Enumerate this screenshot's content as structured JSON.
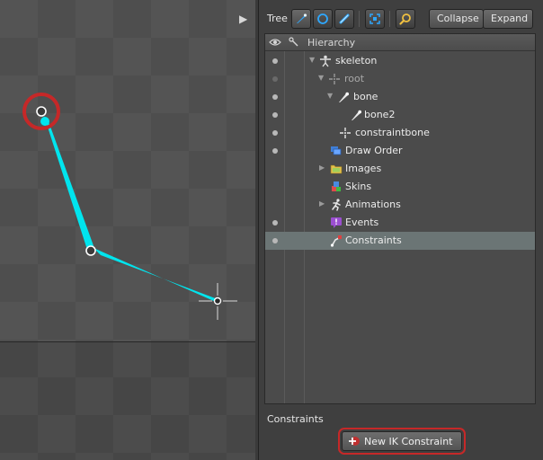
{
  "viewport": {
    "expand_arrow": "▶"
  },
  "toolbar": {
    "tree_label": "Tree",
    "icons": [
      "bone-tool-icon",
      "circle-icon",
      "link-icon",
      "frame-icon",
      "search-icon"
    ],
    "collapse_label": "Collapse",
    "expand_label": "Expand"
  },
  "tree": {
    "header": {
      "visibility_icon": "eye-icon",
      "keying_icon": "bone-link-icon",
      "title": "Hierarchy"
    },
    "rows": [
      {
        "label": "skeleton",
        "icon": "skeleton-icon",
        "visible": true,
        "expander": "down",
        "dim": false
      },
      {
        "label": "root",
        "icon": "crosshair-icon",
        "visible": false,
        "expander": "down",
        "dim": true
      },
      {
        "label": "bone",
        "icon": "bone-icon",
        "visible": true,
        "expander": "down",
        "dim": false
      },
      {
        "label": "bone2",
        "icon": "bone-icon",
        "visible": true,
        "expander": "none",
        "dim": false
      },
      {
        "label": "constraintbone",
        "icon": "crosshair-icon",
        "visible": true,
        "expander": "none",
        "dim": false
      },
      {
        "label": "Draw Order",
        "icon": "draw-order-icon",
        "visible": true,
        "expander": "none",
        "dim": false
      },
      {
        "label": "Images",
        "icon": "folder-icon",
        "visible": false,
        "expander": "right",
        "dim": false
      },
      {
        "label": "Skins",
        "icon": "skins-icon",
        "visible": false,
        "expander": "none",
        "dim": false
      },
      {
        "label": "Animations",
        "icon": "animation-icon",
        "visible": false,
        "expander": "right",
        "dim": false
      },
      {
        "label": "Events",
        "icon": "event-icon",
        "visible": true,
        "expander": "none",
        "dim": false
      },
      {
        "label": "Constraints",
        "icon": "constraint-icon",
        "visible": true,
        "expander": "none",
        "dim": false,
        "selected": true
      }
    ]
  },
  "section": {
    "title": "Constraints",
    "new_button_label": "New IK Constraint",
    "new_button_icon": "add-constraint-icon",
    "highlight_color": "#c62828"
  },
  "colors": {
    "bone": "#00e5ee",
    "selected_row": "#6b7575",
    "highlight": "#c62828"
  }
}
